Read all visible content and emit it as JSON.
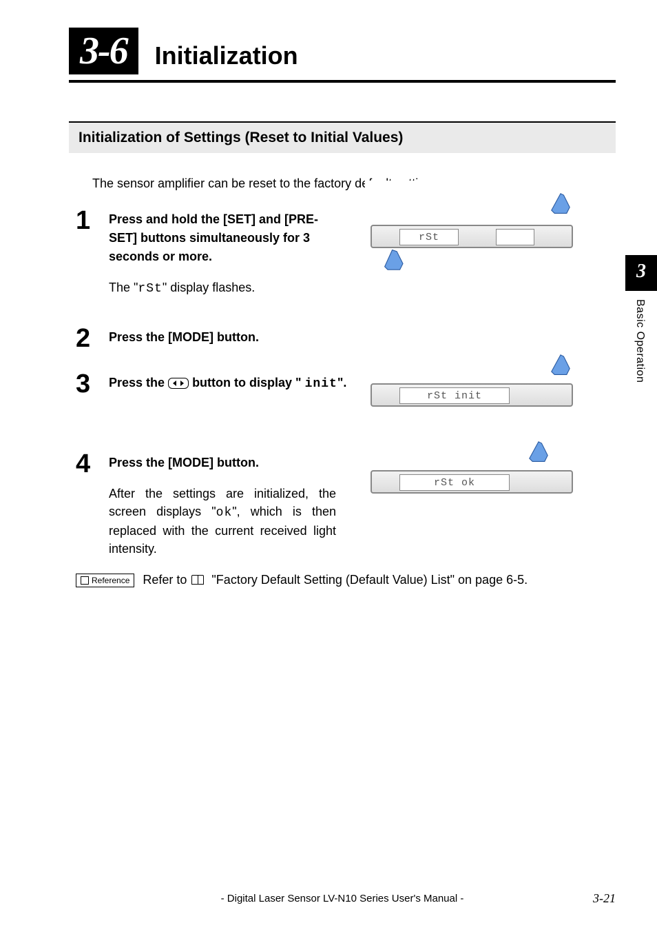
{
  "chapter": {
    "number": "3-6",
    "title": "Initialization"
  },
  "section": {
    "title": "Initialization of Settings (Reset to Initial Values)"
  },
  "intro": "The sensor amplifier can be reset to the factory default settings.",
  "steps": {
    "s1": {
      "num": "1",
      "instr": "Press and hold the [SET] and [PRE-SET] buttons simultaneously for 3 seconds or more.",
      "detail_pre": "The \"",
      "detail_seg": "rSt",
      "detail_post": "\" display flashes.",
      "illus_disp": "rSt"
    },
    "s2": {
      "num": "2",
      "instr": "Press the [MODE] button."
    },
    "s3": {
      "num": "3",
      "instr_pre": "Press the ",
      "instr_mid": " button to display \" ",
      "instr_seg": "init",
      "instr_post": "\".",
      "illus_disp": "rSt init"
    },
    "s4": {
      "num": "4",
      "instr": "Press the [MODE] button.",
      "detail_pre": "After the settings are initialized, the screen displays \"",
      "detail_seg": "ok",
      "detail_post": "\", which is then replaced with the current received light intensity.",
      "illus_disp": "rSt   ok"
    }
  },
  "reference": {
    "badge": "Reference",
    "text_pre": "Refer to ",
    "text_mid": " \"Factory Default Setting (Default Value) List\" on page 6-5."
  },
  "side": {
    "num": "3",
    "label": "Basic Operation"
  },
  "footer": {
    "title": "- Digital Laser Sensor LV-N10 Series User's Manual -",
    "page": "3-21"
  }
}
